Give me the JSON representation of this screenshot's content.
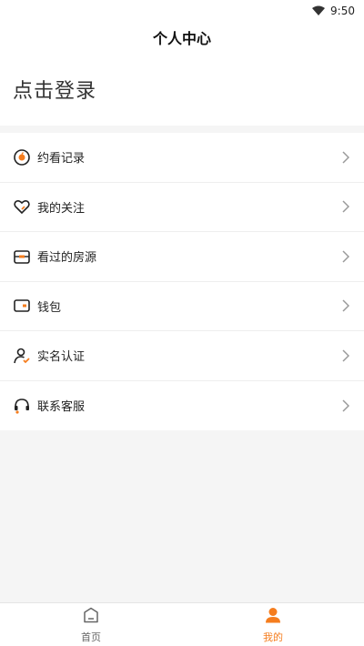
{
  "status_bar": {
    "time": "9:50"
  },
  "header": {
    "title": "个人中心"
  },
  "login": {
    "prompt": "点击登录"
  },
  "menu": {
    "items": [
      {
        "label": "约看记录",
        "icon": "record-icon"
      },
      {
        "label": "我的关注",
        "icon": "heart-icon"
      },
      {
        "label": "看过的房源",
        "icon": "house-icon"
      },
      {
        "label": "钱包",
        "icon": "wallet-icon"
      },
      {
        "label": "实名认证",
        "icon": "user-verify-icon"
      },
      {
        "label": "联系客服",
        "icon": "headset-icon"
      }
    ]
  },
  "tabs": [
    {
      "label": "首页",
      "active": false
    },
    {
      "label": "我的",
      "active": true
    }
  ],
  "colors": {
    "accent": "#f57d1e",
    "text": "#222222",
    "background": "#f5f5f5"
  }
}
